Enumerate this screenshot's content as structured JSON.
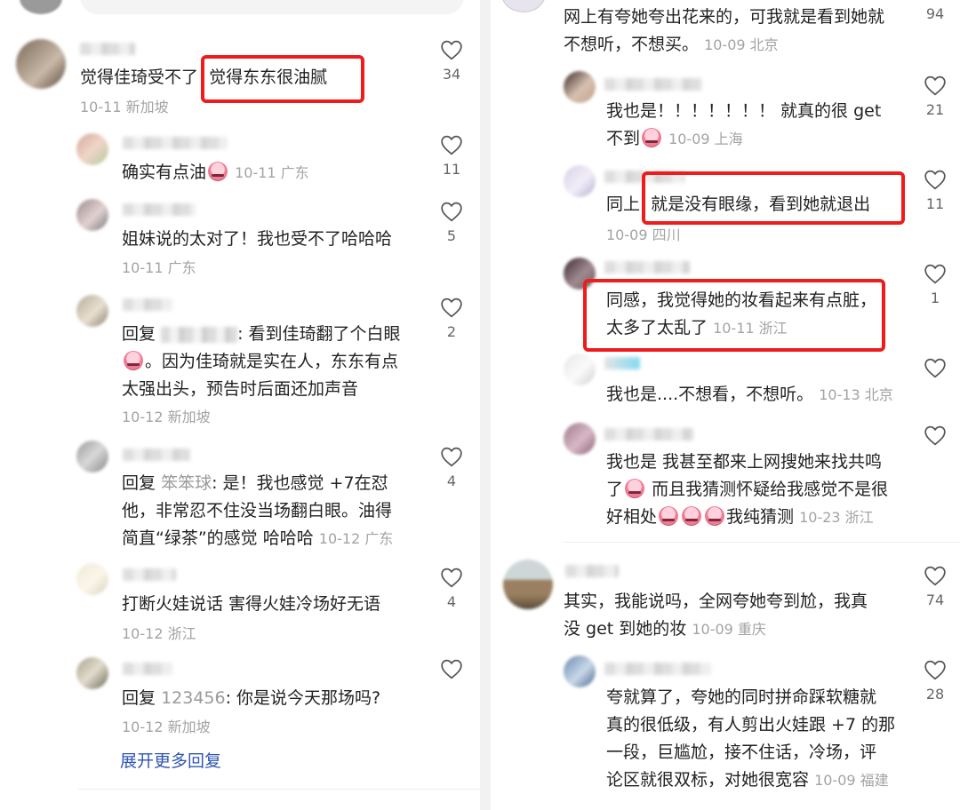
{
  "left": {
    "comments": [
      {
        "text_a": "觉得佳琦受不了",
        "text_b": "觉得东东很油腻",
        "meta": "10-11 新加坡",
        "likes": "34"
      },
      {
        "text": "确实有点油",
        "meta": "10-11 广东",
        "likes": "11"
      },
      {
        "text": "姐妹说的太对了！我也受不了哈哈哈",
        "meta": "10-11 广东",
        "likes": "5"
      },
      {
        "reply_prefix": "回复",
        "text_1": ": 看到佳琦翻了个白眼",
        "text_2": "。因为佳琦就是实在人，东东有点",
        "text_3": "太强出头，预告时后面还加声音",
        "meta": "10-12 新加坡",
        "likes": "2"
      },
      {
        "reply_prefix": "回复",
        "reply_to": "笨笨球",
        "text_1": ": 是！我也感觉 +7在怼",
        "text_2": "他，非常忍不住没当场翻白眼。油得",
        "text_3": "简直“绿茶”的感觉 哈哈哈",
        "meta": "10-12 广东",
        "likes": "4"
      },
      {
        "text": "打断火娃说话 害得火娃冷场好无语",
        "meta": "10-12 浙江",
        "likes": "4"
      },
      {
        "reply_prefix": "回复",
        "reply_to": "123456",
        "text": ": 你是说今天那场吗?",
        "meta": "10-12 新加坡",
        "likes": ""
      }
    ],
    "expand_label": "展开更多回复"
  },
  "right": {
    "comments": [
      {
        "text_1": "网上有夸她夸出花来的，可我就是看到她就",
        "text_2": "不想听，不想买。",
        "meta": "10-09 北京",
        "likes": "94"
      },
      {
        "text_1": "我也是！！！！！！！ 就真的很 get",
        "text_2": "不到",
        "meta": "10-09 上海",
        "likes": "21"
      },
      {
        "text_a": "同上",
        "text_b": "就是没有眼缘，看到她就退出",
        "meta": "10-09 四川",
        "likes": "11"
      },
      {
        "text_1": "同感，我觉得她的妆看起来有点脏，",
        "text_2": "太多了太乱了",
        "meta": "10-11 浙江",
        "likes": "1"
      },
      {
        "text": "我也是....不想看，不想听。",
        "meta": "10-13 北京",
        "likes": ""
      },
      {
        "text_1": "我也是 我甚至都来上网搜她来找共鸣",
        "text_2a": "了",
        "text_2b": "而且我猜测怀疑给我感觉不是很",
        "text_3a": "好相处",
        "text_3b": "我纯猜测",
        "meta": "10-23 浙江",
        "likes": ""
      },
      {
        "text_1": "其实，我能说吗，全网夸她夸到尬，我真",
        "text_2": "没 get 到她的妆",
        "meta": "10-09 重庆",
        "likes": "74"
      },
      {
        "text_1": "夸就算了，夸她的同时拼命踩软糖就",
        "text_2": "真的很低级，有人剪出火娃跟 +7 的那",
        "text_3": "一段，巨尴尬，接不住话，冷场，评",
        "text_4": "论区就很双标，对她很宽容",
        "meta": "10-09 福建",
        "likes": "28"
      }
    ]
  },
  "colors": {
    "highlight_box": "#ee1c1c",
    "link": "#2f56b0",
    "meta": "#a3a3a3"
  }
}
